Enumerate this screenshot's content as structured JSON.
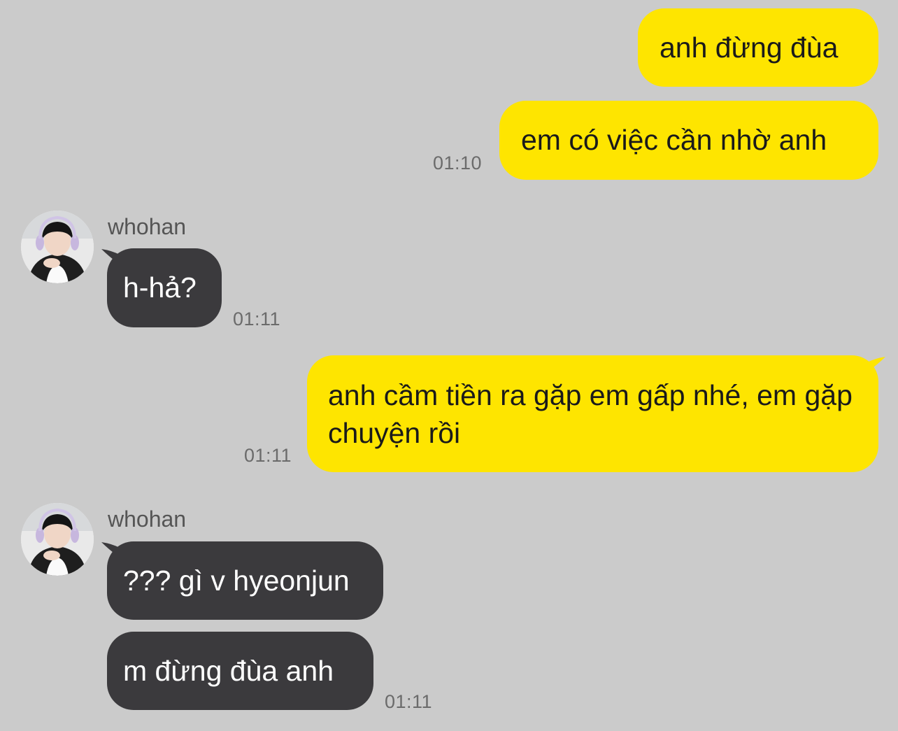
{
  "messages": [
    {
      "sender": "me",
      "text": "anh đừng đùa"
    },
    {
      "sender": "me",
      "text": "em có việc cần nhờ anh",
      "time": "01:10"
    },
    {
      "sender": "whohan",
      "text": "h-hả?",
      "time": "01:11"
    },
    {
      "sender": "me",
      "text": "anh cầm tiền ra gặp em gấp nhé, em gặp chuyện rồi",
      "time": "01:11"
    },
    {
      "sender": "whohan",
      "text": "??? gì v hyeonjun"
    },
    {
      "sender": "whohan",
      "text": "m đừng đùa anh",
      "time": "01:11"
    }
  ],
  "contact": {
    "name": "whohan",
    "avatar_icon": "profile-avatar-icon"
  },
  "colors": {
    "background": "#cbcbcb",
    "my_bubble": "#fee500",
    "their_bubble": "#3b3a3d",
    "timestamp": "#6b6b6b"
  }
}
